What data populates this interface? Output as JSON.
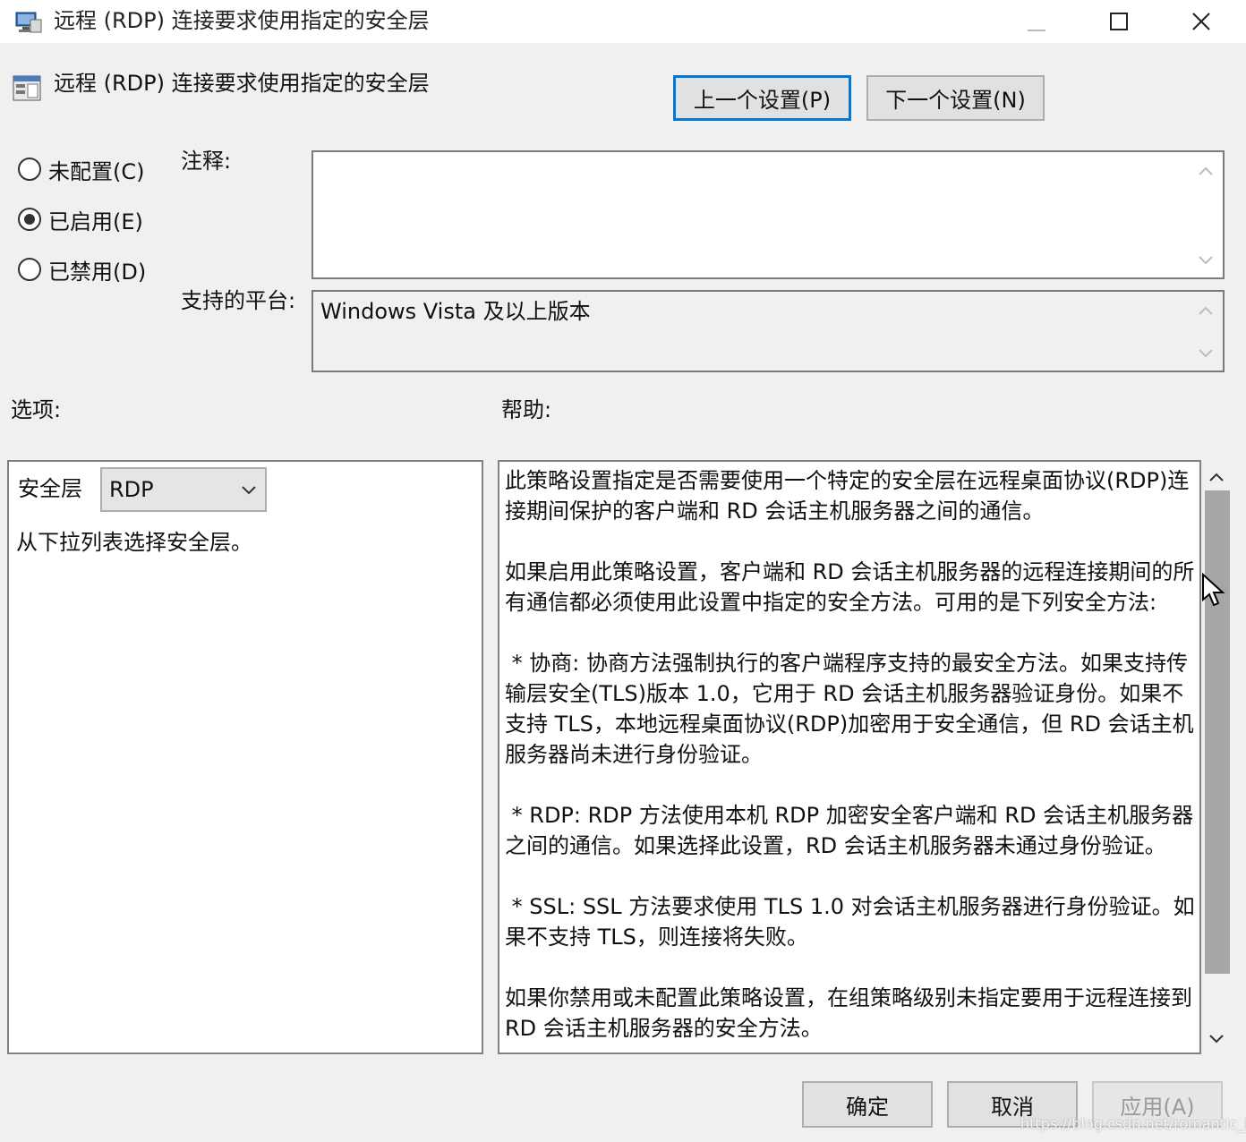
{
  "window": {
    "title": "远程 (RDP) 连接要求使用指定的安全层",
    "icon": "computer-policy-icon",
    "controls": {
      "minimize": "minimize-icon",
      "maximize": "maximize-icon",
      "close": "close-icon"
    }
  },
  "header": {
    "setting_title": "远程 (RDP) 连接要求使用指定的安全层",
    "setting_icon": "policy-setting-icon",
    "prev_button": "上一个设置(P)",
    "next_button": "下一个设置(N)"
  },
  "state": {
    "options": [
      {
        "label": "未配置(C)",
        "selected": false
      },
      {
        "label": "已启用(E)",
        "selected": true
      },
      {
        "label": "已禁用(D)",
        "selected": false
      }
    ]
  },
  "comment": {
    "label": "注释:",
    "value": ""
  },
  "platform": {
    "label": "支持的平台:",
    "value": "Windows Vista 及以上版本"
  },
  "options_section": {
    "label": "选项:",
    "security_layer_label": "安全层",
    "security_layer_value": "RDP",
    "description": "从下拉列表选择安全层。"
  },
  "help_section": {
    "label": "帮助:",
    "text": "此策略设置指定是否需要使用一个特定的安全层在远程桌面协议(RDP)连接期间保护的客户端和 RD 会话主机服务器之间的通信。\n\n如果启用此策略设置，客户端和 RD 会话主机服务器的远程连接期间的所有通信都必须使用此设置中指定的安全方法。可用的是下列安全方法:\n\n * 协商: 协商方法强制执行的客户端程序支持的最安全方法。如果支持传输层安全(TLS)版本 1.0，它用于 RD 会话主机服务器验证身份。如果不支持 TLS，本地远程桌面协议(RDP)加密用于安全通信，但 RD 会话主机服务器尚未进行身份验证。\n\n * RDP: RDP 方法使用本机 RDP 加密安全客户端和 RD 会话主机服务器之间的通信。如果选择此设置，RD 会话主机服务器未通过身份验证。\n\n * SSL: SSL 方法要求使用 TLS 1.0 对会话主机服务器进行身份验证。如果不支持 TLS，则连接将失败。\n\n如果你禁用或未配置此策略设置，在组策略级别未指定要用于远程连接到 RD 会话主机服务器的安全方法。"
  },
  "footer": {
    "ok": "确定",
    "cancel": "取消",
    "apply": "应用(A)"
  },
  "watermark": "https://blog.csdn.net/romantic_love"
}
